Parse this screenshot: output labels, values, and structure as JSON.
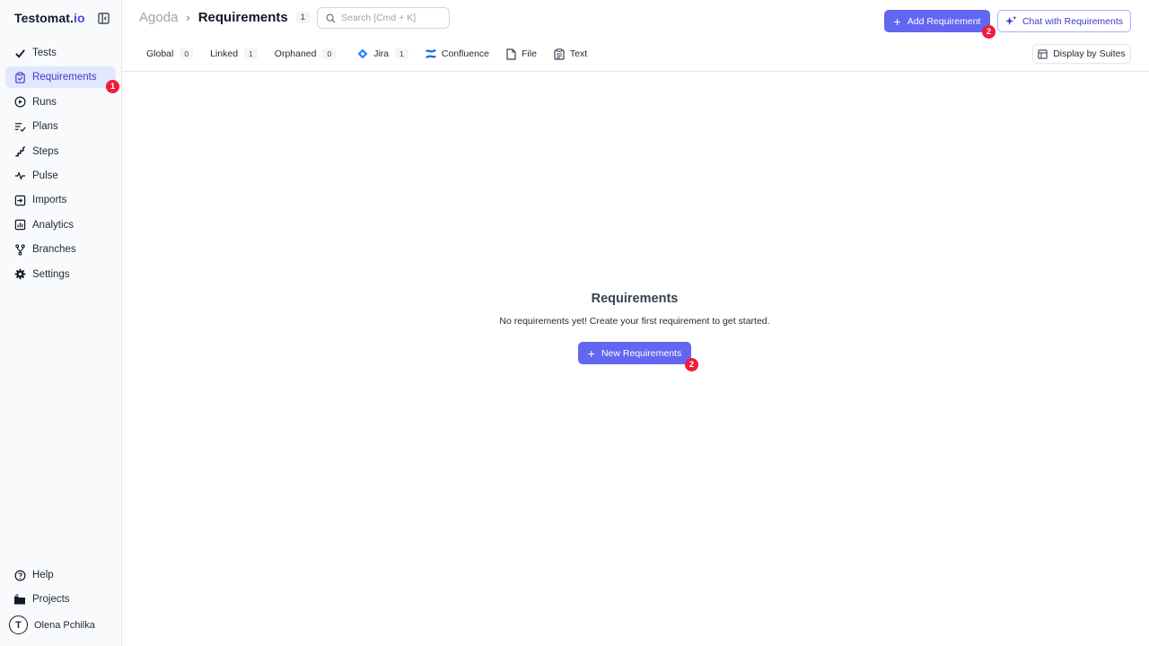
{
  "app": {
    "logo_main": "Testomat.",
    "logo_suffix": "io"
  },
  "sidebar": {
    "items": [
      {
        "label": "Tests",
        "icon": "check-icon"
      },
      {
        "label": "Requirements",
        "icon": "clipboard-icon",
        "active": true,
        "badge": "1"
      },
      {
        "label": "Runs",
        "icon": "play-circle-icon"
      },
      {
        "label": "Plans",
        "icon": "plans-icon"
      },
      {
        "label": "Steps",
        "icon": "steps-icon"
      },
      {
        "label": "Pulse",
        "icon": "pulse-icon"
      },
      {
        "label": "Imports",
        "icon": "import-icon"
      },
      {
        "label": "Analytics",
        "icon": "analytics-icon"
      },
      {
        "label": "Branches",
        "icon": "branch-icon"
      },
      {
        "label": "Settings",
        "icon": "gear-icon"
      }
    ],
    "bottom": [
      {
        "label": "Help",
        "icon": "help-icon"
      },
      {
        "label": "Projects",
        "icon": "folder-icon"
      }
    ],
    "user": {
      "name": "Olena Pchilka",
      "initial": "T"
    }
  },
  "header": {
    "project": "Agoda",
    "separator": "›",
    "title": "Requirements",
    "count": "1",
    "search_placeholder": "Search [Cmd + K]",
    "add_button": "Add Requirement",
    "add_badge": "2",
    "chat_button": "Chat with Requirements"
  },
  "tabs": [
    {
      "label": "Global",
      "count": "0"
    },
    {
      "label": "Linked",
      "count": "1"
    },
    {
      "label": "Orphaned",
      "count": "0"
    },
    {
      "label": "Jira",
      "count": "1",
      "icon": "jira-icon"
    },
    {
      "label": "Confluence",
      "icon": "confluence-icon"
    },
    {
      "label": "File",
      "icon": "file-icon"
    },
    {
      "label": "Text",
      "icon": "text-icon"
    }
  ],
  "display_button": "Display by Suites",
  "empty_state": {
    "title": "Requirements",
    "message": "No requirements yet! Create your first requirement to get started.",
    "button": "New Requirements",
    "badge": "2"
  },
  "colors": {
    "accent": "#6366f1",
    "active_bg": "#e0e7ff",
    "badge": "#ef1c3a",
    "jira": "#2684ff",
    "confluence": "#1868db"
  }
}
